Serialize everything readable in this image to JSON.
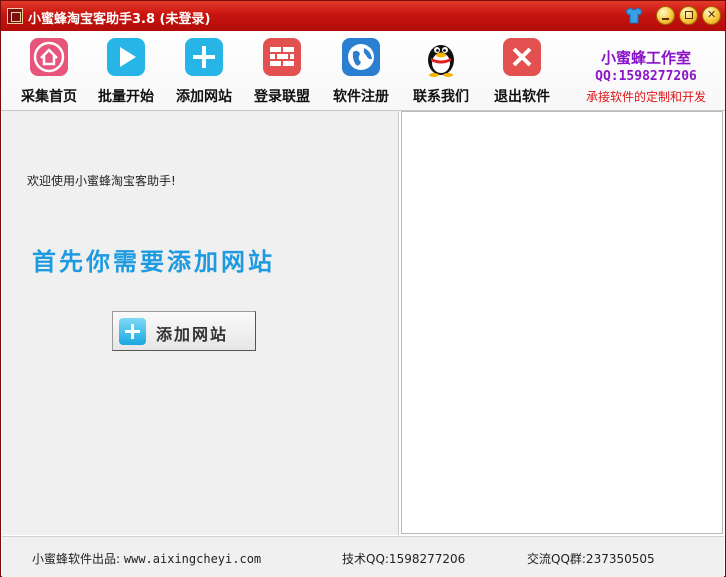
{
  "window": {
    "title": "小蜜蜂淘宝客助手3.8 (未登录)"
  },
  "toolbar": {
    "items": [
      {
        "label": "采集首页",
        "icon": "home-icon",
        "color": "#e8557a"
      },
      {
        "label": "批量开始",
        "icon": "play-icon",
        "color": "#26b5e6"
      },
      {
        "label": "添加网站",
        "icon": "add-icon",
        "color": "#26b5e6"
      },
      {
        "label": "登录联盟",
        "icon": "brick-wall-icon",
        "color": "#e25050"
      },
      {
        "label": "软件注册",
        "icon": "globe-icon",
        "color": "#2a7fd0"
      },
      {
        "label": "联系我们",
        "icon": "qq-penguin-icon",
        "color": "#111111"
      },
      {
        "label": "退出软件",
        "icon": "close-icon",
        "color": "#e25050"
      }
    ]
  },
  "studio": {
    "name": "小蜜蜂工作室",
    "qq": "QQ:1598277206",
    "slogan": "承接软件的定制和开发"
  },
  "main": {
    "welcome": "欢迎使用小蜜蜂淘宝客助手!",
    "hint": "首先你需要添加网站",
    "add_button_label": "添加网站"
  },
  "statusbar": {
    "producer_label": "小蜜蜂软件出品:",
    "website": "www.aixingcheyi.com",
    "tech_qq": "技术QQ:1598277206",
    "qq_group": "交流QQ群:237350505"
  },
  "colors": {
    "titlebar": "#c8140f",
    "accent_blue": "#1e9be0",
    "studio_purple": "#8a14c8",
    "slogan_red": "#e0151a"
  }
}
